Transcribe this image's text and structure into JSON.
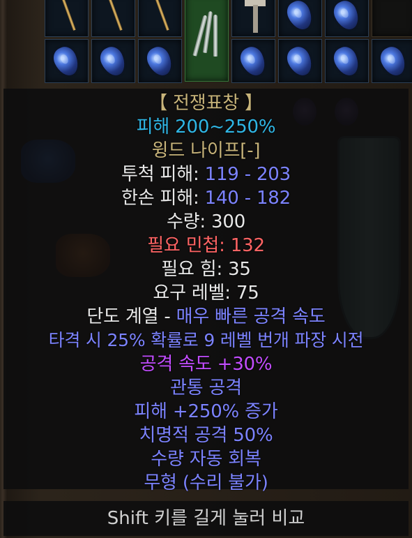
{
  "tooltip": {
    "title": "【 전쟁표창 】",
    "damage_pct": "피해 200~250%",
    "base_name": "윙드 나이프[-]",
    "throw_damage": {
      "label": "투척 피해:",
      "value": "119 - 203"
    },
    "one_hand_damage": {
      "label": "한손 피해:",
      "value": "140 - 182"
    },
    "quantity": {
      "label": "수량:",
      "value": "300"
    },
    "req_dex": {
      "label": "필요 민첩:",
      "value": "132"
    },
    "req_str": {
      "label": "필요 힘:",
      "value": "35"
    },
    "req_level": {
      "label": "요구 레벨:",
      "value": "75"
    },
    "weapon_class": {
      "label": "단도 계열 -",
      "value": "매우 빠른 공격 속도"
    },
    "mods": [
      "타격 시 25% 확률로 9 레벨 번개 파장 시전",
      "공격 속도 +30%",
      "관통 공격",
      "피해 +250% 증가",
      "치명적 공격 50%",
      "수량 자동 회복",
      "무형 (수리 불가)"
    ]
  },
  "footer": {
    "hint": "Shift 키를 길게 눌러 비교"
  },
  "colors": {
    "title": "#c8b47a",
    "magic_blue": "#7c83ff",
    "cyan": "#2fb6e5",
    "requirement_unmet": "#ff6464",
    "ias_purple": "#c24dff"
  }
}
